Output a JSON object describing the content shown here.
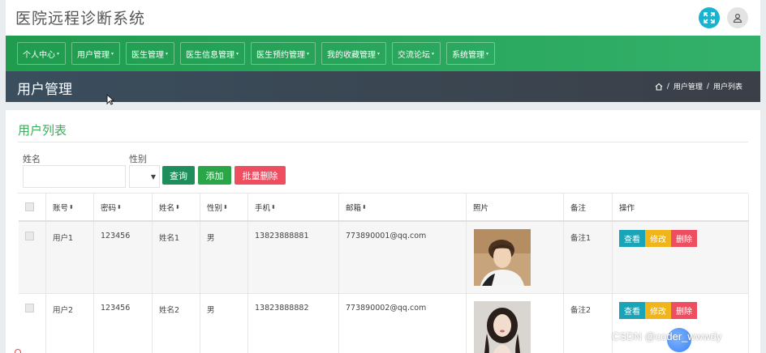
{
  "app": {
    "title": "医院远程诊断系统"
  },
  "nav": {
    "items": [
      {
        "label": "个人中心"
      },
      {
        "label": "用户管理"
      },
      {
        "label": "医生管理"
      },
      {
        "label": "医生信息管理"
      },
      {
        "label": "医生预约管理"
      },
      {
        "label": "我的收藏管理"
      },
      {
        "label": "交流论坛"
      },
      {
        "label": "系统管理"
      }
    ]
  },
  "page": {
    "title": "用户管理",
    "breadcrumb": [
      "用户管理",
      "用户列表"
    ]
  },
  "panel": {
    "title": "用户列表",
    "search": {
      "name_label": "姓名",
      "name_value": "",
      "sex_label": "性别",
      "sex_value": ""
    },
    "buttons": {
      "query": "查询",
      "add": "添加",
      "batch_delete": "批量删除"
    }
  },
  "table": {
    "headers": {
      "account": "账号",
      "password": "密码",
      "name": "姓名",
      "sex": "性别",
      "phone": "手机",
      "email": "邮箱",
      "photo": "照片",
      "note": "备注",
      "action": "操作"
    },
    "rows": [
      {
        "account": "用户1",
        "password": "123456",
        "name": "姓名1",
        "sex": "男",
        "phone": "13823888881",
        "email": "773890001@qq.com",
        "note": "备注1"
      },
      {
        "account": "用户2",
        "password": "123456",
        "name": "姓名2",
        "sex": "男",
        "phone": "13823888882",
        "email": "773890002@qq.com",
        "note": "备注2"
      }
    ],
    "actions": {
      "view": "查看",
      "edit": "修改",
      "delete": "删除"
    }
  },
  "watermark": "CSDN @coder_wwwdy",
  "colors": {
    "accent": "#3dac5c",
    "nav": "#1f9c4e",
    "header_dark": "#3b3f47",
    "query": "#1f8e5c",
    "add": "#2aa548",
    "danger": "#ef4d60",
    "view": "#1aa4b8",
    "edit": "#f0b51a"
  },
  "icons": {
    "expand": "expand-icon",
    "user": "user-icon",
    "home": "home-icon",
    "sort": "sort-icon",
    "dropdown": "chevron-down-icon"
  }
}
